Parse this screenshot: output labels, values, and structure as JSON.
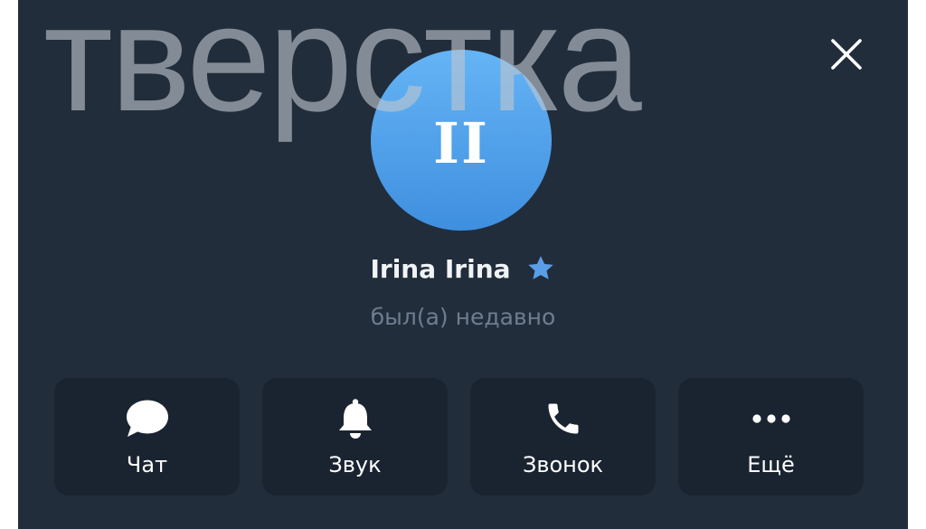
{
  "watermark": {
    "text": "тверстка"
  },
  "dialog": {
    "close_icon": "close-icon"
  },
  "profile": {
    "avatar_initials": "II",
    "name": "Irina Irina",
    "badge_icon": "star-icon",
    "status": "был(а) недавно"
  },
  "actions": [
    {
      "label": "Чат",
      "icon": "chat-bubble-icon"
    },
    {
      "label": "Звук",
      "icon": "bell-icon"
    },
    {
      "label": "Звонок",
      "icon": "phone-icon"
    },
    {
      "label": "Ещё",
      "icon": "more-dots-icon"
    }
  ],
  "colors": {
    "panel_background": "#222d3b",
    "button_background": "#1a2431",
    "avatar_gradient_top": "#65b4f5",
    "avatar_gradient_bottom": "#3f8fe0",
    "star": "#5b9ee8",
    "status_text": "#6d7e90"
  }
}
